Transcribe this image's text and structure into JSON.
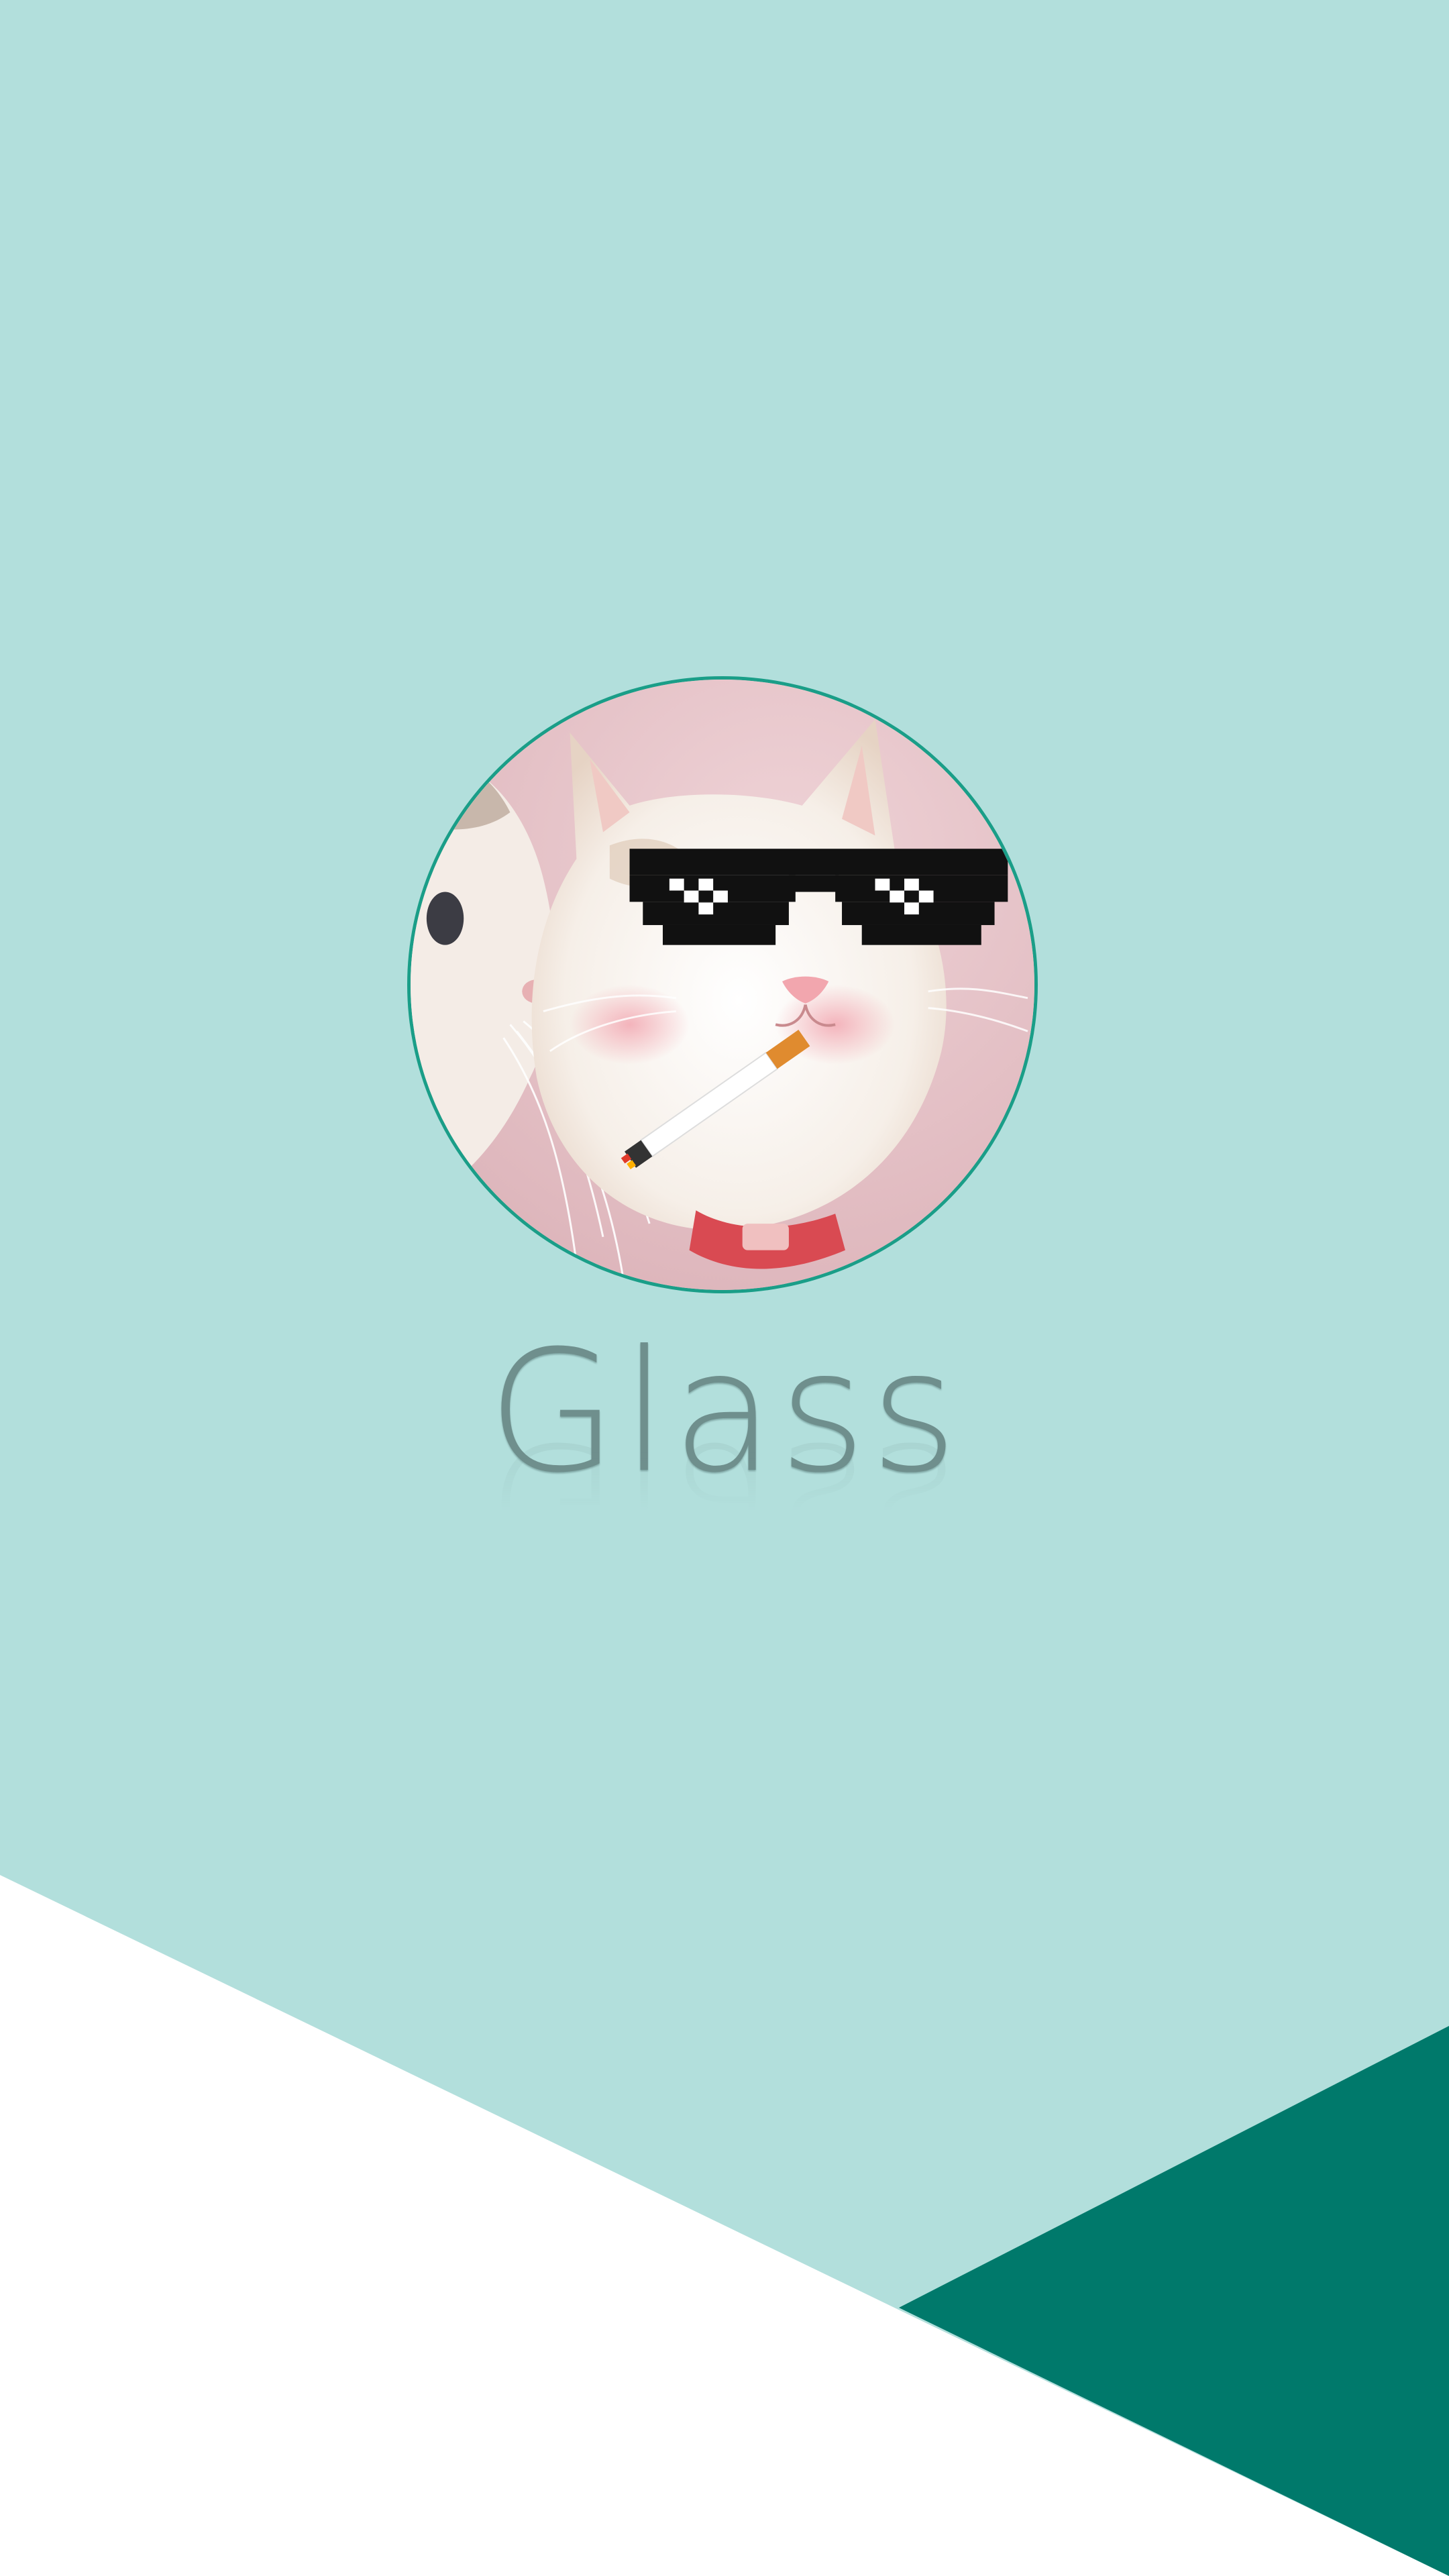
{
  "app": {
    "title": "Glass"
  },
  "avatar": {
    "image": "cat-with-pixel-sunglasses-and-cigarette"
  },
  "colors": {
    "background": "#b2dfdc",
    "accent_dark": "#00796b",
    "bottom_band": "#ffffff",
    "avatar_border": "#1a9e88",
    "title_text": "#6f8f8d"
  }
}
